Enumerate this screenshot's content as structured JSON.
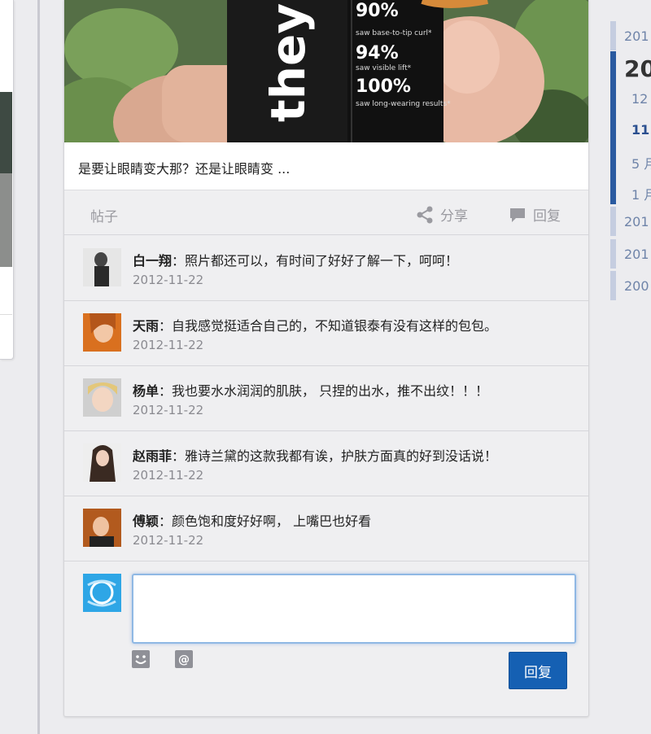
{
  "post": {
    "caption": "是要让眼睛变大那？还是让眼睛变 ...",
    "posts_label": "帖子",
    "share_label": "分享",
    "reply_label": "回复",
    "photo_text": {
      "brand": "they're",
      "stat1": "90%",
      "stat1_desc": "saw base-to-tip curl*",
      "stat2": "94%",
      "stat2_desc": "saw visible lift*",
      "stat3": "100%",
      "stat3_desc": "saw long-wearing results*"
    }
  },
  "comments": [
    {
      "name": "白一翔",
      "text": "照片都还可以，有时间了好好了解一下，呵呵！",
      "date": "2012-11-22"
    },
    {
      "name": "天雨",
      "text": "自我感觉挺适合自己的，不知道银泰有没有这样的包包。",
      "date": "2012-11-22"
    },
    {
      "name": "杨单",
      "text": "我也要水水润润的肌肤， 只捏的出水，推不出纹！！！",
      "date": "2012-11-22"
    },
    {
      "name": "赵雨菲",
      "text": "雅诗兰黛的这款我都有诶，护肤方面真的好到没话说！",
      "date": "2012-11-22"
    },
    {
      "name": "傅颖",
      "text": "颜色饱和度好好啊， 上嘴巴也好看",
      "date": "2012-11-22"
    }
  ],
  "composer": {
    "placeholder": "",
    "submit_label": "回复"
  },
  "timeline": {
    "top_year": "201",
    "current_year": "20",
    "months": [
      "12",
      "11",
      "5 月",
      "1 月"
    ],
    "current_month": "11",
    "other_years": [
      "201",
      "201",
      "200"
    ]
  },
  "colors": {
    "accent": "#1560b3",
    "timeline_active": "#2a5aa0",
    "timeline_inactive": "#c5cde0"
  }
}
